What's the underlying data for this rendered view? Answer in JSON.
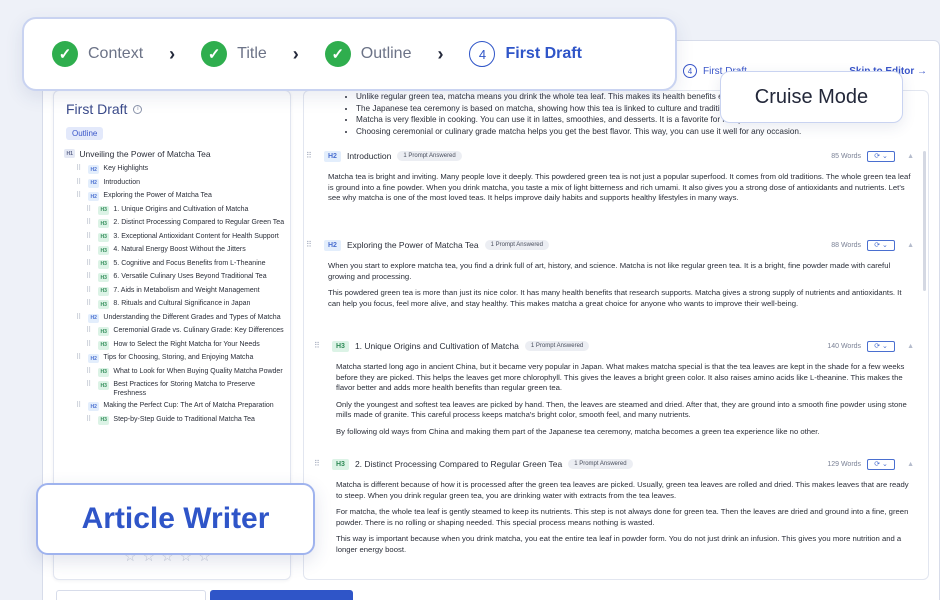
{
  "steps": [
    {
      "label": "Context",
      "state": "done"
    },
    {
      "label": "Title",
      "state": "done"
    },
    {
      "label": "Outline",
      "state": "done"
    },
    {
      "label": "First Draft",
      "state": "active",
      "number": "4"
    }
  ],
  "mini_step": {
    "number": "4",
    "label": "First Draft",
    "skip": "Skip to Editor →"
  },
  "cruise_mode": "Cruise Mode",
  "article_writer": "Article Writer",
  "left": {
    "title": "First Draft",
    "tab": "Outline",
    "items": [
      {
        "level": "H1",
        "text": "Unveiling the Power of Matcha Tea"
      },
      {
        "level": "H2",
        "text": "Key Highlights"
      },
      {
        "level": "H2",
        "text": "Introduction"
      },
      {
        "level": "H2",
        "text": "Exploring the Power of Matcha Tea"
      },
      {
        "level": "H3",
        "text": "1. Unique Origins and Cultivation of Matcha"
      },
      {
        "level": "H3",
        "text": "2. Distinct Processing Compared to Regular Green Tea"
      },
      {
        "level": "H3",
        "text": "3. Exceptional Antioxidant Content for Health Support"
      },
      {
        "level": "H3",
        "text": "4. Natural Energy Boost Without the Jitters"
      },
      {
        "level": "H3",
        "text": "5. Cognitive and Focus Benefits from L-Theanine"
      },
      {
        "level": "H3",
        "text": "6. Versatile Culinary Uses Beyond Traditional Tea"
      },
      {
        "level": "H3",
        "text": "7. Aids in Metabolism and Weight Management"
      },
      {
        "level": "H3",
        "text": "8. Rituals and Cultural Significance in Japan"
      },
      {
        "level": "H2",
        "text": "Understanding the Different Grades and Types of Matcha"
      },
      {
        "level": "H3",
        "text": "Ceremonial Grade vs. Culinary Grade: Key Differences"
      },
      {
        "level": "H3",
        "text": "How to Select the Right Matcha for Your Needs"
      },
      {
        "level": "H2",
        "text": "Tips for Choosing, Storing, and Enjoying Matcha"
      },
      {
        "level": "H3",
        "text": "What to Look for When Buying Quality Matcha Powder"
      },
      {
        "level": "H3",
        "text": "Best Practices for Storing Matcha to Preserve Freshness"
      },
      {
        "level": "H2",
        "text": "Making the Perfect Cup: The Art of Matcha Preparation"
      },
      {
        "level": "H3",
        "text": "Step-by-Step Guide to Traditional Matcha Tea"
      }
    ]
  },
  "bullets": [
    "Unlike regular green tea, matcha means you drink the whole tea leaf. This makes its health benefits even stronger.",
    "The Japanese tea ceremony is based on matcha, showing how this tea is linked to culture and tradition.",
    "Matcha is very flexible in cooking. You can use it in lattes, smoothies, and desserts. It is a favorite for many.",
    "Choosing ceremonial or culinary grade matcha helps you get the best flavor. This way, you can use it well for any occasion."
  ],
  "sections": [
    {
      "level": "H2",
      "title": "Introduction",
      "badge": "1 Prompt Answered",
      "words": "85 Words",
      "paragraphs": [
        "Matcha tea is bright and inviting. Many people love it deeply. This powdered green tea is not just a popular superfood. It comes from old traditions. The whole green tea leaf is ground into a fine powder. When you drink matcha, you taste a mix of light bitterness and rich umami. It also gives you a strong dose of antioxidants and nutrients. Let's see why matcha is one of the most loved teas. It helps improve daily habits and supports healthy lifestyles in many ways."
      ]
    },
    {
      "level": "H2",
      "title": "Exploring the Power of Matcha Tea",
      "badge": "1 Prompt Answered",
      "words": "88 Words",
      "paragraphs": [
        "When you start to explore matcha tea, you find a drink full of art, history, and science. Matcha is not like regular green tea. It is a bright, fine powder made with careful growing and processing.",
        "This powdered green tea is more than just its nice color. It has many health benefits that research supports. Matcha gives a strong supply of nutrients and antioxidants. It can help you focus, feel more alive, and stay healthy. This makes matcha a great choice for anyone who wants to improve their well-being."
      ]
    },
    {
      "level": "H3",
      "title": "1. Unique Origins and Cultivation of Matcha",
      "badge": "1 Prompt Answered",
      "words": "140 Words",
      "paragraphs": [
        "Matcha started long ago in ancient China, but it became very popular in Japan. What makes matcha special is that the tea leaves are kept in the shade for a few weeks before they are picked. This helps the leaves get more chlorophyll. This gives the leaves a bright green color. It also raises amino acids like L-theanine. This makes the flavor better and adds more health benefits than regular green tea.",
        "Only the youngest and softest tea leaves are picked by hand. Then, the leaves are steamed and dried. After that, they are ground into a smooth fine powder using stone mills made of granite. This careful process keeps matcha's bright color, smooth feel, and many nutrients.",
        "By following old ways from China and making them part of the Japanese tea ceremony, matcha becomes a green tea experience like no other."
      ]
    },
    {
      "level": "H3",
      "title": "2. Distinct Processing Compared to Regular Green Tea",
      "badge": "1 Prompt Answered",
      "words": "129 Words",
      "paragraphs": [
        "Matcha is different because of how it is processed after the green tea leaves are picked. Usually, green tea leaves are rolled and dried. This makes leaves that are ready to steep. When you drink regular green tea, you are drinking water with extracts from the tea leaves.",
        "For matcha, the whole tea leaf is gently steamed to keep its nutrients. This step is not always done for green tea. Then the leaves are dried and ground into a fine, green powder. There is no rolling or shaping needed. This special process means nothing is wasted.",
        "This way is important because when you drink matcha, you eat the entire tea leaf in powder form. You do not just drink an infusion. This gives you more nutrition and a longer energy boost."
      ]
    }
  ]
}
